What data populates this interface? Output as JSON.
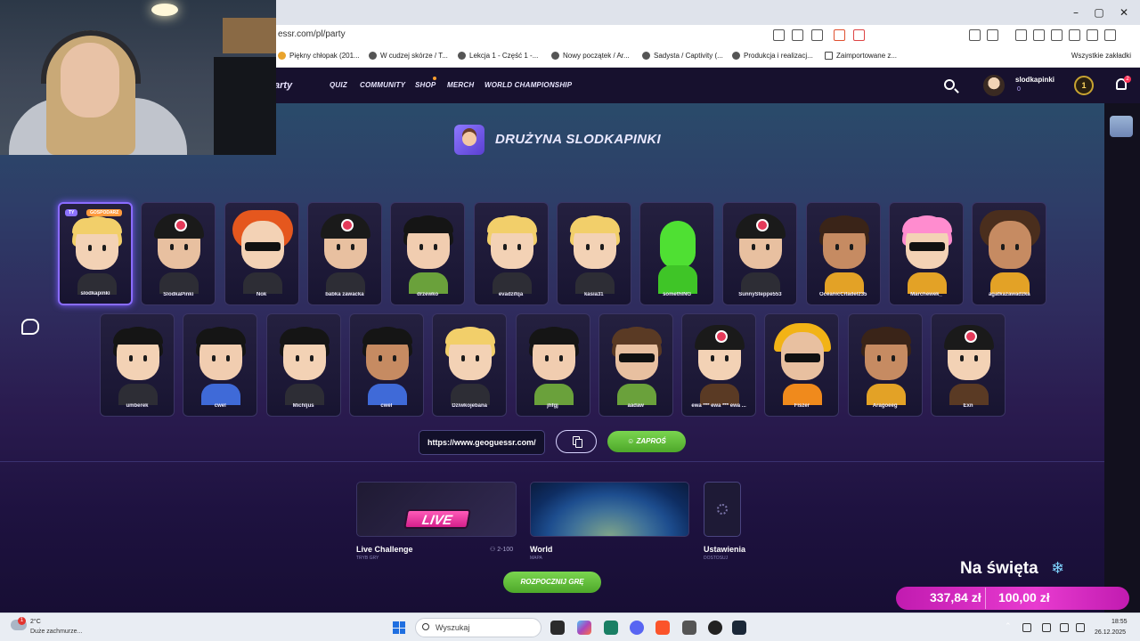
{
  "browser": {
    "url": "essr.com/pl/party",
    "bookmarks": [
      "Piękny chłopak (201...",
      "W cudzej skórze / T...",
      "Lekcja 1 - Część 1 -...",
      "Nowy początek / Ar...",
      "Sadysta / Captivity (...",
      "Produkcja i realizacj...",
      "Zaimportowane z..."
    ],
    "all_bookmarks": "Wszystkie zakładki"
  },
  "header": {
    "brand": "arty",
    "nav": [
      "QUIZ",
      "COMMUNITY",
      "SHOP",
      "MERCH",
      "WORLD CHAMPIONSHIP"
    ],
    "username": "slodkapinki",
    "coins": "0",
    "level": "1",
    "notifications": "2"
  },
  "party": {
    "title": "DRUŻYNA SLODKAPINKI",
    "tag_you": "TY",
    "tag_host": "GOSPODARZ",
    "row1": [
      "slodkapinki",
      "SlodkaPinki",
      "Nok",
      "babka zawacka",
      "drzewko",
      "evadzifqa",
      "kasia31",
      "somethING",
      "SunnySteppe553",
      "OceanicCitadel235",
      "Marchewek_",
      "agatkazawadzka"
    ],
    "row2": [
      "umberek",
      "cwel",
      "Michljus",
      "cwel",
      "Dziwkojebana",
      "jhfgj",
      "aadaw",
      "ewa *** ewa *** ewa ...",
      "Fiszer",
      "Aragoeeg",
      "Exn"
    ],
    "invite_url": "https://www.geoguessr.com/",
    "invite_button": "ZAPROŚ"
  },
  "modes": {
    "live": {
      "badge": "LIVE",
      "title": "Live Challenge",
      "subtitle": "TRYB GRY",
      "players": "2-100"
    },
    "world": {
      "title": "World",
      "subtitle": "MAPA"
    },
    "settings": {
      "title": "Ustawienia",
      "subtitle": "DOSTOSUJ"
    },
    "start_button": "ROZPOCZNIJ GRĘ"
  },
  "promo": {
    "title": "Na święta",
    "amount_a": "337,84 zł",
    "amount_b": "100,00 zł"
  },
  "taskbar": {
    "temperature": "2°C",
    "weather": "Duże zachmurze...",
    "weather_badge": "1",
    "search_placeholder": "Wyszukaj",
    "time": "18:55",
    "date": "26.12.2025"
  }
}
